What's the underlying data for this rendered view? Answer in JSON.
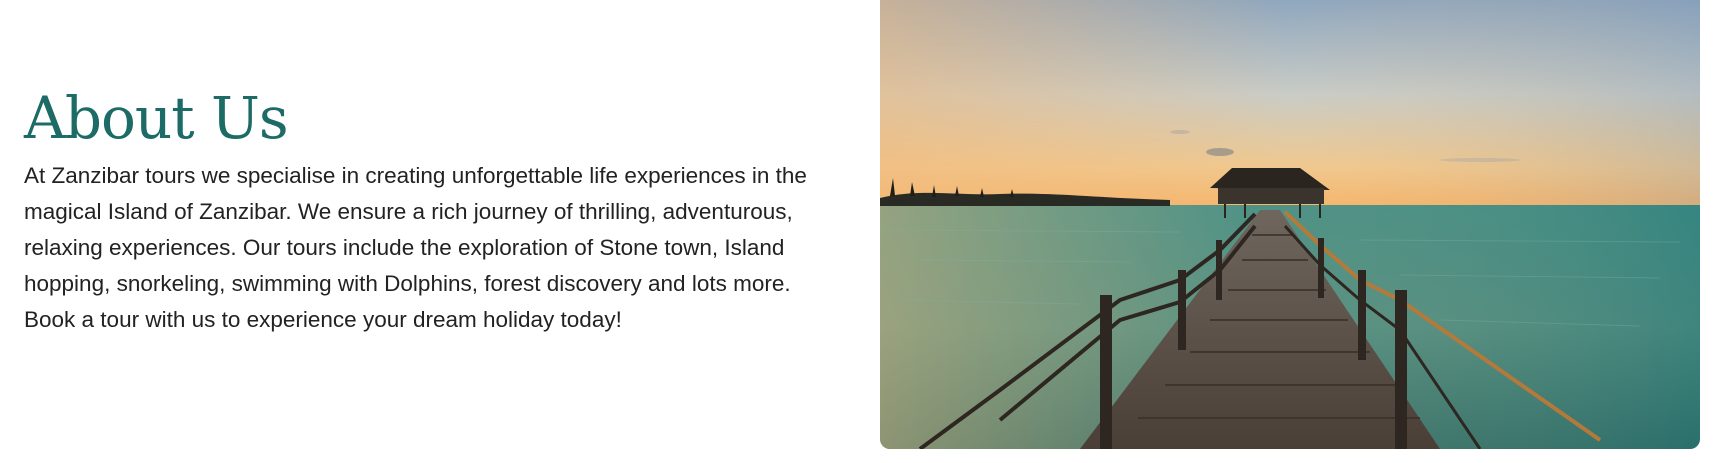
{
  "about": {
    "title": "About Us",
    "description": "At Zanzibar tours we specialise in creating unforgettable life experiences in the magical Island of Zanzibar. We ensure a rich journey of thrilling, adventurous, relaxing experiences. Our tours include the exploration of Stone town, Island hopping, snorkeling, swimming with Dolphins, forest discovery and lots more. Book a tour with us to experience your dream holiday today!"
  },
  "colors": {
    "heading": "#1c6b66",
    "body_text": "#222222",
    "background": "#ffffff"
  }
}
